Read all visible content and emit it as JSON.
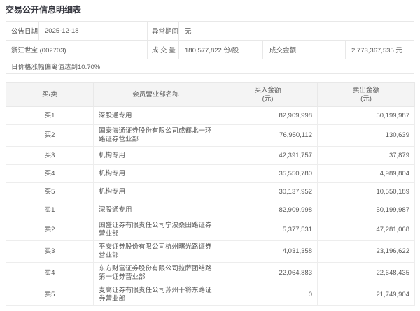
{
  "page": {
    "title": "交易公开信息明细表"
  },
  "info": {
    "announce_date_label": "公告日期",
    "announce_date": "2025-12-18",
    "abnormal_period_label": "异常期间",
    "abnormal_period": "无",
    "stock_name_code": "浙江世宝 (002703)",
    "volume_label": "成 交 量",
    "volume_value": "180,577,822 份/股",
    "turnover_label": "成交金额",
    "turnover_value": "2,773,367,535 元",
    "deviation_note": "日价格涨幅偏离值达到10.70%"
  },
  "table": {
    "headers": {
      "side": "买/卖",
      "branch": "会员营业部名称",
      "buy": "买入金额\n(元)",
      "sell": "卖出金额\n(元)"
    },
    "rows": [
      {
        "side": "买1",
        "branch": "深股通专用",
        "buy": "82,909,998",
        "sell": "50,199,987"
      },
      {
        "side": "买2",
        "branch": "国泰海通证券股份有限公司成都北一环路证券营业部",
        "buy": "76,950,112",
        "sell": "130,639"
      },
      {
        "side": "买3",
        "branch": "机构专用",
        "buy": "42,391,757",
        "sell": "37,879"
      },
      {
        "side": "买4",
        "branch": "机构专用",
        "buy": "35,550,780",
        "sell": "4,989,804"
      },
      {
        "side": "买5",
        "branch": "机构专用",
        "buy": "30,137,952",
        "sell": "10,550,189"
      },
      {
        "side": "卖1",
        "branch": "深股通专用",
        "buy": "82,909,998",
        "sell": "50,199,987"
      },
      {
        "side": "卖2",
        "branch": "国盛证券有限责任公司宁波桑田路证券营业部",
        "buy": "5,377,531",
        "sell": "47,281,068"
      },
      {
        "side": "卖3",
        "branch": "平安证券股份有限公司杭州曙光路证券营业部",
        "buy": "4,031,358",
        "sell": "23,196,622"
      },
      {
        "side": "卖4",
        "branch": "东方财富证券股份有限公司拉萨团结路第一证券营业部",
        "buy": "22,064,883",
        "sell": "22,648,435"
      },
      {
        "side": "卖5",
        "branch": "麦高证券有限责任公司苏州干将东路证券营业部",
        "buy": "0",
        "sell": "21,749,904"
      }
    ]
  },
  "colors": {
    "title_text": "#35363f",
    "body_text": "#595959",
    "border": "#e8e8e8",
    "header_bg": "#f4f4f4",
    "page_bg": "#ffffff"
  }
}
